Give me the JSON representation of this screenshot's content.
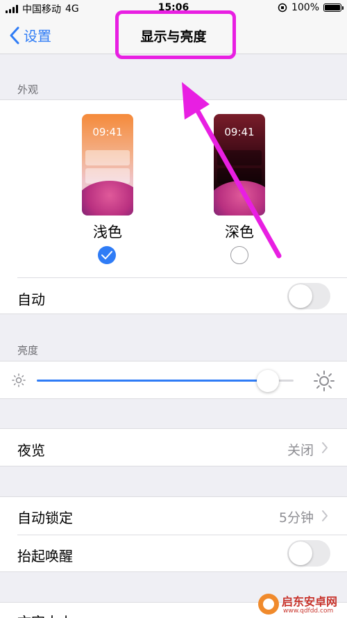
{
  "status_bar": {
    "carrier": "中国移动",
    "network": "4G",
    "time": "15:06",
    "battery_percent": "100%",
    "battery_level": 1.0
  },
  "nav": {
    "back_label": "设置",
    "title": "显示与亮度"
  },
  "appearance": {
    "section_label": "外观",
    "light": {
      "preview_time": "09:41",
      "label": "浅色",
      "selected": true
    },
    "dark": {
      "preview_time": "09:41",
      "label": "深色",
      "selected": false
    },
    "auto_label": "自动",
    "auto_on": false
  },
  "brightness": {
    "section_label": "亮度",
    "level": 0.9
  },
  "night_shift": {
    "label": "夜览",
    "value": "关闭"
  },
  "auto_lock": {
    "label": "自动锁定",
    "value": "5分钟"
  },
  "raise_to_wake": {
    "label": "抬起唤醒",
    "on": false
  },
  "text_size": {
    "label": "文字大小"
  },
  "watermark": {
    "brand": "启东安卓网",
    "url": "www.qdfdd.com"
  },
  "colors": {
    "accent": "#2f7cf6",
    "annotation": "#e81fe2",
    "background": "#efeff4"
  }
}
